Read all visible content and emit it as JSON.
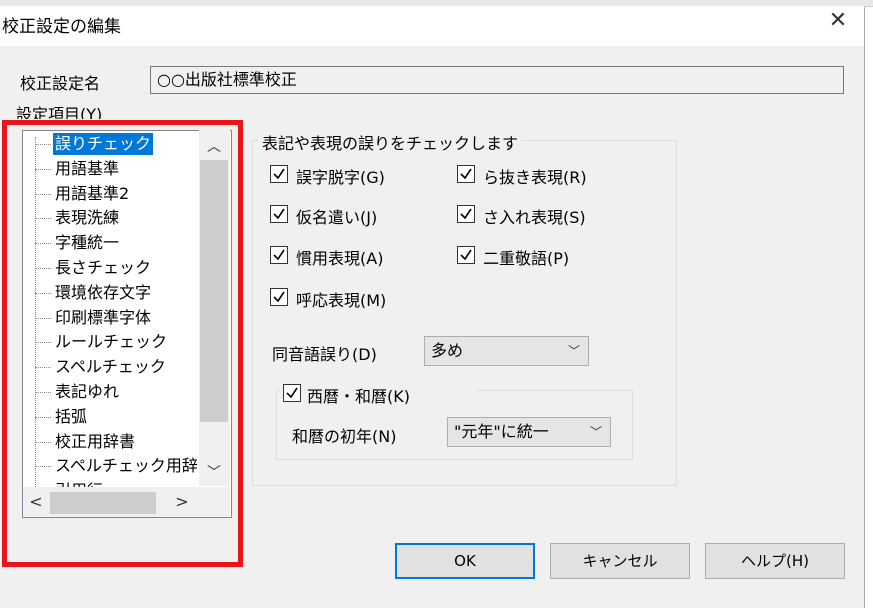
{
  "window": {
    "title": "校正設定の編集",
    "close_glyph": "✕"
  },
  "setting_name": {
    "label": "校正設定名",
    "value": "○○出版社標準校正"
  },
  "items_label": "設定項目(Y)",
  "tree": {
    "items": [
      "誤りチェック",
      "用語基準",
      "用語基準2",
      "表現洗練",
      "字種統一",
      "長さチェック",
      "環境依存文字",
      "印刷標準字体",
      "ルールチェック",
      "スペルチェック",
      "表記ゆれ",
      "括弧",
      "校正用辞書",
      "スペルチェック用辞",
      "引用行"
    ],
    "selected_index": 0
  },
  "group": {
    "title": "表記や表現の誤りをチェックします",
    "checkboxes": [
      {
        "label": "誤字脱字(G)",
        "checked": true
      },
      {
        "label": "ら抜き表現(R)",
        "checked": true
      },
      {
        "label": "仮名遣い(J)",
        "checked": true
      },
      {
        "label": "さ入れ表現(S)",
        "checked": true
      },
      {
        "label": "慣用表現(A)",
        "checked": true
      },
      {
        "label": "二重敬語(P)",
        "checked": true
      },
      {
        "label": "呼応表現(M)",
        "checked": true
      }
    ],
    "homophone": {
      "label": "同音語誤り(D)",
      "value": "多め"
    },
    "calendar": {
      "checkbox_label": "西暦・和暦(K)",
      "checked": true,
      "first_year_label": "和暦の初年(N)",
      "first_year_value": "\"元年\"に統一"
    }
  },
  "buttons": {
    "ok": "OK",
    "cancel": "キャンセル",
    "help": "ヘルプ(H)"
  },
  "colors": {
    "selection": "#0078d7",
    "highlight_border": "#e8161a"
  }
}
